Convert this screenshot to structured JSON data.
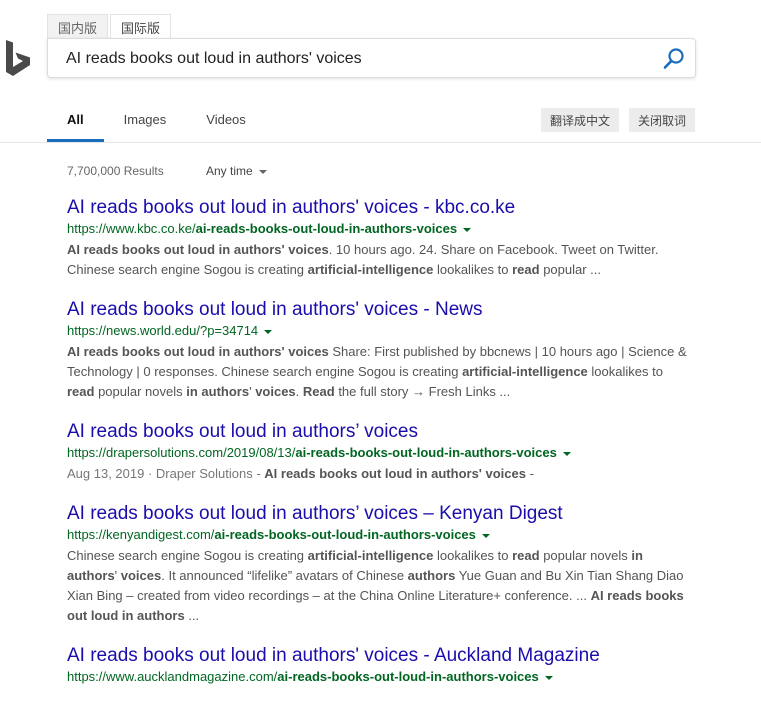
{
  "region_tabs": [
    "国内版",
    "国际版"
  ],
  "search": {
    "query": "AI reads books out loud in authors' voices"
  },
  "nav": {
    "items": [
      "All",
      "Images",
      "Videos"
    ]
  },
  "tools": {
    "translate": "翻译成中文",
    "close_translate": "关闭取词"
  },
  "meta": {
    "result_count": "7,700,000 Results",
    "time_filter": "Any time"
  },
  "results": [
    {
      "title": "AI reads books out loud in authors' voices - kbc.co.ke",
      "url_base": "https://www.kbc.co.ke/",
      "url_bold": "ai-reads-books-out-loud-in-authors-voices",
      "snippet": [
        {
          "t": "AI reads books out loud in authors' voices",
          "b": true
        },
        {
          "t": ". 10 hours ago. 24. Share on Facebook. Tweet on Twitter. Chinese search engine Sogou is creating "
        },
        {
          "t": "artificial-intelligence",
          "b": true
        },
        {
          "t": " lookalikes to "
        },
        {
          "t": "read",
          "b": true
        },
        {
          "t": " popular ..."
        }
      ]
    },
    {
      "title": "AI reads books out loud in authors' voices - News",
      "url_base": "https://news.world.edu/?p=34714",
      "url_bold": "",
      "snippet": [
        {
          "t": "AI reads books out loud in authors' voices",
          "b": true
        },
        {
          "t": " Share: First published by bbcnews | 10 hours ago | Science & Technology | 0 responses. Chinese search engine Sogou is creating "
        },
        {
          "t": "artificial-intelligence",
          "b": true
        },
        {
          "t": " lookalikes to "
        },
        {
          "t": "read",
          "b": true
        },
        {
          "t": " popular novels "
        },
        {
          "t": "in authors",
          "b": true
        },
        {
          "t": "' "
        },
        {
          "t": "voices",
          "b": true
        },
        {
          "t": ". "
        },
        {
          "t": "Read",
          "b": true
        },
        {
          "t": " the full story → Fresh Links ..."
        }
      ]
    },
    {
      "title": "AI reads books out loud in authors’ voices",
      "url_base": "https://drapersolutions.com/2019/08/13/",
      "url_bold": "ai-reads-books-out-loud-in-authors-voices",
      "snippet": [
        {
          "t": "Aug 13, 2019 · Draper Solutions - ",
          "d": true
        },
        {
          "t": "AI reads books out loud in authors' voices",
          "b": true
        },
        {
          "t": " -"
        }
      ]
    },
    {
      "title": "AI reads books out loud in authors’ voices – Kenyan Digest",
      "url_base": "https://kenyandigest.com/",
      "url_bold": "ai-reads-books-out-loud-in-authors-voices",
      "snippet": [
        {
          "t": "Chinese search engine Sogou is creating "
        },
        {
          "t": "artificial-intelligence",
          "b": true
        },
        {
          "t": " lookalikes to "
        },
        {
          "t": "read",
          "b": true
        },
        {
          "t": " popular novels "
        },
        {
          "t": "in authors",
          "b": true
        },
        {
          "t": "' "
        },
        {
          "t": "voices",
          "b": true
        },
        {
          "t": ". It announced “lifelike” avatars of Chinese "
        },
        {
          "t": "authors",
          "b": true
        },
        {
          "t": " Yue Guan and Bu Xin Tian Shang Diao Xian Bing – created from video recordings – at the China Online Literature+ conference. ... "
        },
        {
          "t": "AI reads books out loud in authors",
          "b": true
        },
        {
          "t": " ..."
        }
      ]
    },
    {
      "title": "AI reads books out loud in authors' voices - Auckland Magazine",
      "url_base": "https://www.aucklandmagazine.com/",
      "url_bold": "ai-reads-books-out-loud-in-authors-voices",
      "snippet": []
    }
  ]
}
